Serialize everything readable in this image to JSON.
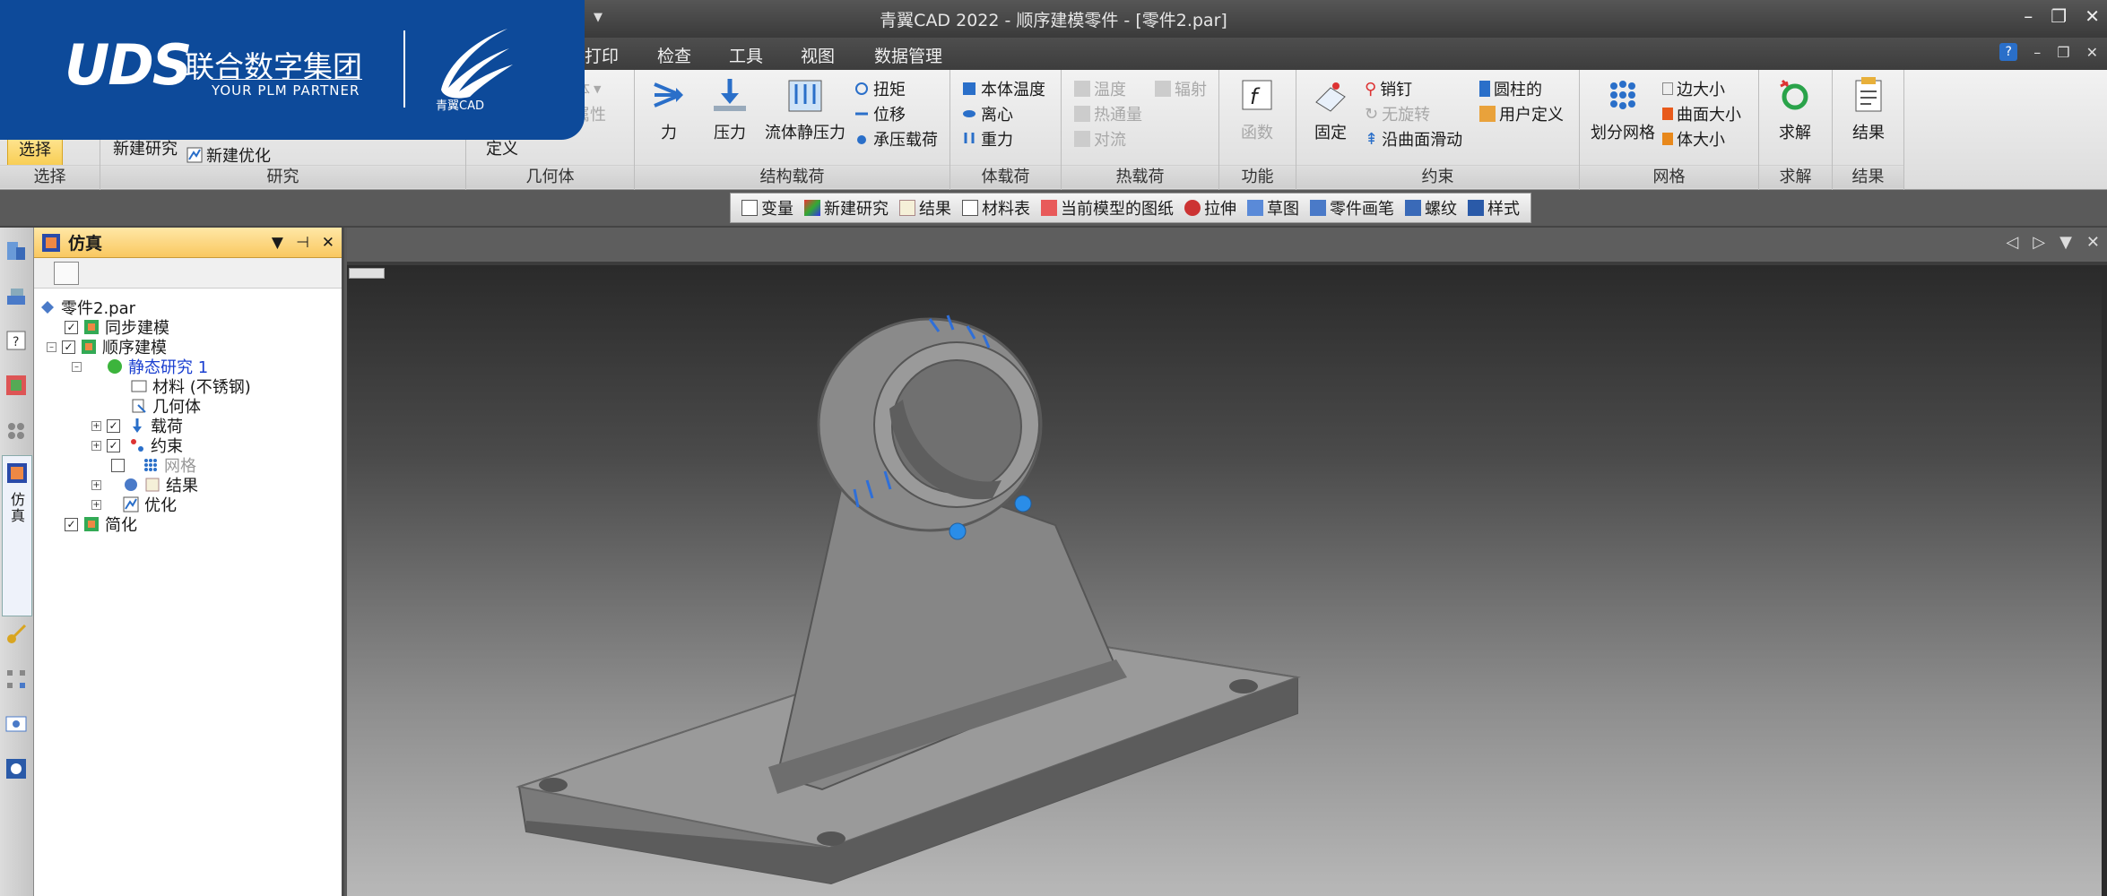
{
  "window": {
    "title": "青翼CAD 2022 - 顺序建模零件 - [零件2.par]"
  },
  "logo": {
    "uds": "UDS",
    "brand_cn": "联合数字集团",
    "brand_en": "YOUR PLM PARTNER",
    "product": "青翼CAD"
  },
  "tabs": [
    "打印",
    "检查",
    "工具",
    "视图",
    "数据管理"
  ],
  "ribbon": {
    "select": {
      "label": "选择",
      "group": "选择"
    },
    "study": {
      "new_study": "新建研究",
      "new_opt": "新建优化",
      "group": "研究"
    },
    "geometry": {
      "body": "体",
      "props": "属性",
      "define": "定义",
      "group": "几何体"
    },
    "structural": {
      "force": "力",
      "pressure": "压力",
      "fluid": "流体静压力",
      "torque": "扭矩",
      "displacement": "位移",
      "bearing": "承压载荷",
      "group": "结构载荷"
    },
    "body_loads": {
      "temp": "本体温度",
      "centrifugal": "离心",
      "gravity": "重力",
      "group": "体载荷"
    },
    "thermal": {
      "temperature": "温度",
      "radiation": "辐射",
      "heat_flux": "热通量",
      "convection": "对流",
      "group": "热载荷"
    },
    "function": {
      "func": "函数",
      "group": "功能"
    },
    "constraints": {
      "fixed": "固定",
      "pin": "销钉",
      "no_rotation": "无旋转",
      "slide": "沿曲面滑动",
      "cylindrical": "圆柱的",
      "user_defined": "用户定义",
      "group": "约束"
    },
    "mesh": {
      "divide": "划分网格",
      "edge": "边大小",
      "surface": "曲面大小",
      "body": "体大小",
      "group": "网格"
    },
    "solve": {
      "solve": "求解",
      "group": "求解"
    },
    "results": {
      "results": "结果",
      "group": "结果"
    }
  },
  "toolbar2": [
    "变量",
    "新建研究",
    "结果",
    "材料表",
    "当前模型的图纸",
    "拉伸",
    "草图",
    "零件画笔",
    "螺纹",
    "样式"
  ],
  "leftstrip": {
    "tab_label": "仿真"
  },
  "panel": {
    "title": "仿真",
    "tree": [
      {
        "label": "零件2.par"
      },
      {
        "label": "同步建模"
      },
      {
        "label": "顺序建模"
      },
      {
        "label": "静态研究 1"
      },
      {
        "label": "材料 (不锈钢)"
      },
      {
        "label": "几何体"
      },
      {
        "label": "载荷"
      },
      {
        "label": "约束"
      },
      {
        "label": "网格"
      },
      {
        "label": "结果"
      },
      {
        "label": "优化"
      },
      {
        "label": "简化"
      }
    ]
  },
  "colors": {
    "brand": "#0d4a9a",
    "ribbon_bg": "#e6e6e6",
    "highlight": "#f7c948"
  }
}
